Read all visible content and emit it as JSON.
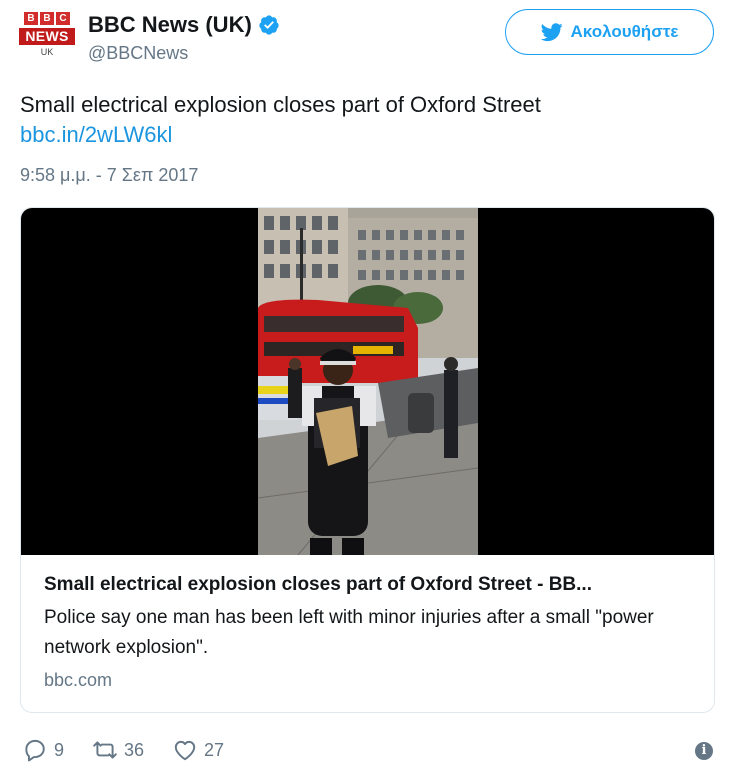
{
  "account": {
    "avatar_logo_text": "BBC",
    "avatar_news_text": "NEWS",
    "avatar_region_text": "UK",
    "display_name": "BBC News (UK)",
    "verified": true,
    "handle": "@BBCNews"
  },
  "follow_button": {
    "label": "Ακολουθήστε",
    "icon": "twitter-bird-icon"
  },
  "tweet": {
    "text": "Small electrical explosion closes part of Oxford Street",
    "link": "bbc.in/2wLW6kl",
    "timestamp": "9:58 μ.μ. - 7 Σεπ 2017"
  },
  "card": {
    "title": "Small electrical explosion closes part of Oxford Street - BB...",
    "description": "Police say one man has been left with minor injuries after a small \"power network explosion\".",
    "domain": "bbc.com",
    "image_alt": "Police officer on Oxford Street with a red double-decker bus behind"
  },
  "actions": {
    "replies": "9",
    "retweets": "36",
    "likes": "27"
  },
  "colors": {
    "accent": "#1da1f2",
    "link": "#1b95e0",
    "muted": "#657786",
    "bbc_red": "#c01a1a"
  }
}
